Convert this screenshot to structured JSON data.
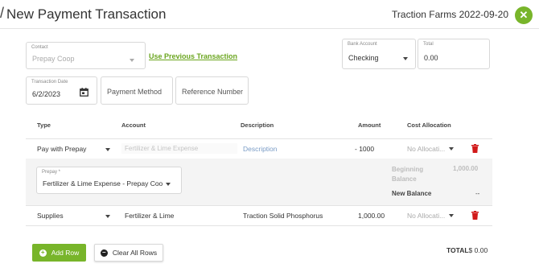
{
  "header": {
    "title": "New Payment Transaction",
    "right_text": "Traction Farms 2022-09-20",
    "close_symbol": "✕"
  },
  "form": {
    "contact": {
      "label": "Contact",
      "value": "Prepay Coop"
    },
    "use_previous": "Use Previous Transaction",
    "bank_account": {
      "label": "Bank Account",
      "value": "Checking"
    },
    "total": {
      "label": "Total",
      "value": "0.00"
    },
    "transaction_date": {
      "label": "Transaction Date",
      "value": "6/2/2023"
    },
    "payment_method": {
      "placeholder": "Payment Method"
    },
    "reference_number": {
      "placeholder": "Reference Number"
    }
  },
  "table": {
    "headers": {
      "type": "Type",
      "account": "Account",
      "description": "Description",
      "amount": "Amount",
      "cost_allocation": "Cost Allocation"
    },
    "rows": [
      {
        "type": "Pay with Prepay",
        "account": "Fertilizer & Lime Expense",
        "description": "Description",
        "amount": "- 1000",
        "cost_allocation": "No Allocati..."
      },
      {
        "type": "Supplies",
        "account": "Fertilizer & Lime",
        "description": "Traction Solid Phosphorus",
        "amount": "1,000.00",
        "cost_allocation": "No Allocati..."
      }
    ],
    "prepay": {
      "label": "Prepay *",
      "value": "Fertilizer & Lime Expense - Prepay Coo",
      "beginning_balance_label": "Beginning Balance",
      "beginning_balance_value": "1,000.00",
      "new_balance_label": "New Balance",
      "new_balance_value": "--"
    }
  },
  "footer": {
    "add_row": "Add Row",
    "clear_rows": "Clear All Rows",
    "total_label": "TOTAL",
    "total_value": "$ 0.00"
  },
  "colors": {
    "accent": "#78b52a",
    "link": "#6aa51e",
    "delete": "#d11a1a"
  },
  "icons": [
    "check-icon-partial",
    "close-icon",
    "chevron-down-icon",
    "calendar-icon",
    "trash-icon",
    "plus-circle-icon",
    "minus-circle-icon"
  ]
}
